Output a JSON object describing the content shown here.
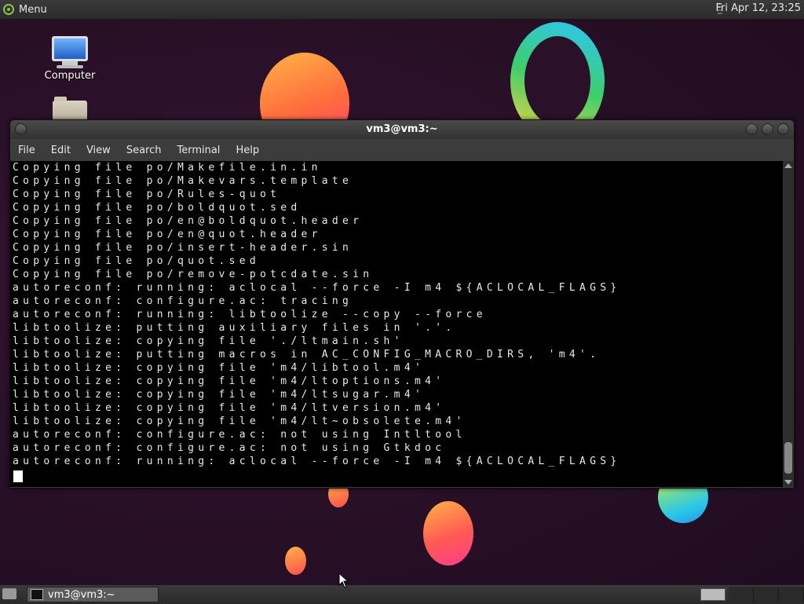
{
  "top_panel": {
    "menu_label": "Menu",
    "clock": "Fri Apr 12, 23:25"
  },
  "desktop": {
    "icons": [
      {
        "label": "Computer"
      },
      {
        "label": ""
      }
    ]
  },
  "window": {
    "title": "vm3@vm3:~",
    "menu": [
      "File",
      "Edit",
      "View",
      "Search",
      "Terminal",
      "Help"
    ],
    "terminal_lines": [
      "Copying file po/Makefile.in.in",
      "Copying file po/Makevars.template",
      "Copying file po/Rules-quot",
      "Copying file po/boldquot.sed",
      "Copying file po/en@boldquot.header",
      "Copying file po/en@quot.header",
      "Copying file po/insert-header.sin",
      "Copying file po/quot.sed",
      "Copying file po/remove-potcdate.sin",
      "autoreconf: running: aclocal --force -I m4 ${ACLOCAL_FLAGS}",
      "autoreconf: configure.ac: tracing",
      "autoreconf: running: libtoolize --copy --force",
      "libtoolize: putting auxiliary files in '.'.",
      "libtoolize: copying file './ltmain.sh'",
      "libtoolize: putting macros in AC_CONFIG_MACRO_DIRS, 'm4'.",
      "libtoolize: copying file 'm4/libtool.m4'",
      "libtoolize: copying file 'm4/ltoptions.m4'",
      "libtoolize: copying file 'm4/ltsugar.m4'",
      "libtoolize: copying file 'm4/ltversion.m4'",
      "libtoolize: copying file 'm4/lt~obsolete.m4'",
      "autoreconf: configure.ac: not using Intltool",
      "autoreconf: configure.ac: not using Gtkdoc",
      "autoreconf: running: aclocal --force -I m4 ${ACLOCAL_FLAGS}"
    ]
  },
  "taskbar": {
    "task_label": "vm3@vm3:~"
  }
}
